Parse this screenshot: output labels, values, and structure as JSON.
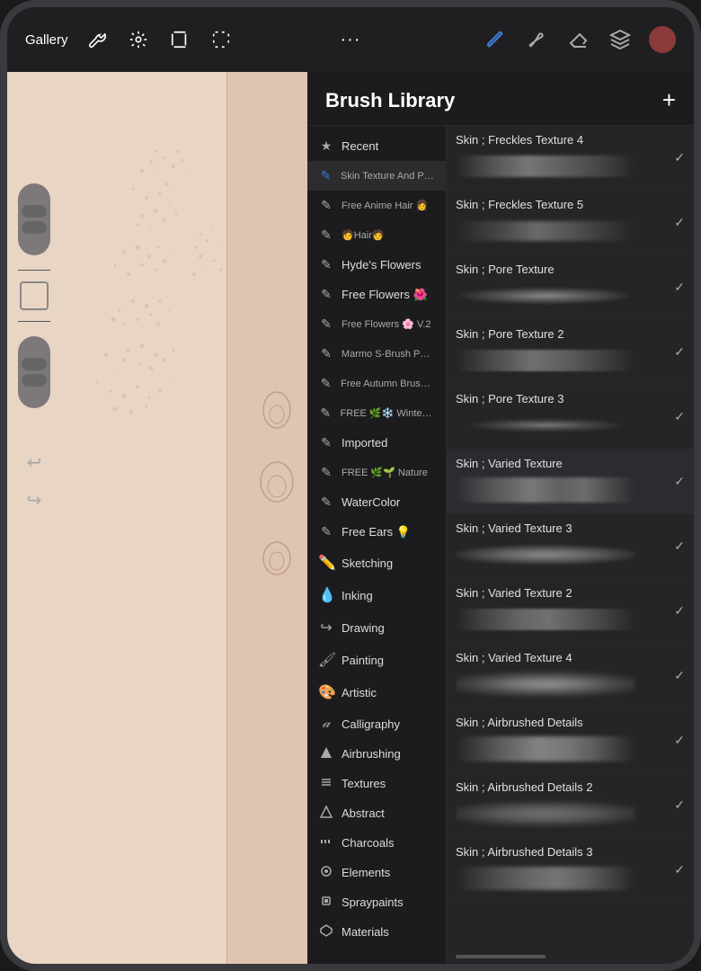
{
  "app": {
    "title": "Brush Library",
    "gallery_label": "Gallery"
  },
  "toolbar": {
    "add_label": "+",
    "three_dots": "···"
  },
  "categories": [
    {
      "id": "recent",
      "icon": "★",
      "label": "Recent",
      "active": false,
      "small": false
    },
    {
      "id": "skin-texture",
      "icon": "✎",
      "label": "Skin Texture And Por...",
      "active": true,
      "small": true
    },
    {
      "id": "free-anime",
      "icon": "✎",
      "label": "Free Anime Hair 👩",
      "active": false,
      "small": true
    },
    {
      "id": "hair",
      "icon": "✎",
      "label": "🧑Hair🧑",
      "active": false,
      "small": true
    },
    {
      "id": "hydes-flowers",
      "icon": "✎",
      "label": "Hyde's Flowers",
      "active": false,
      "small": false
    },
    {
      "id": "free-flowers",
      "icon": "✎",
      "label": "Free Flowers 🌺",
      "active": false,
      "small": false
    },
    {
      "id": "free-flowers2",
      "icon": "✎",
      "label": "Free Flowers 🌸 V.2",
      "active": false,
      "small": true
    },
    {
      "id": "marmo",
      "icon": "✎",
      "label": "Marmo S-Brush Pack",
      "active": false,
      "small": true
    },
    {
      "id": "free-autumn",
      "icon": "✎",
      "label": "Free Autumn Brushe...",
      "active": false,
      "small": true
    },
    {
      "id": "free-winter",
      "icon": "✎",
      "label": "FREE 🌿❄️ Winter N...",
      "active": false,
      "small": true
    },
    {
      "id": "imported",
      "icon": "✎",
      "label": "Imported",
      "active": false,
      "small": false
    },
    {
      "id": "free-nature",
      "icon": "✎",
      "label": "FREE 🌿🌱 Nature",
      "active": false,
      "small": true
    },
    {
      "id": "watercolor",
      "icon": "✎",
      "label": "WaterColor",
      "active": false,
      "small": false
    },
    {
      "id": "free-ears",
      "icon": "✎",
      "label": "Free Ears 💡",
      "active": false,
      "small": false
    },
    {
      "id": "sketching",
      "icon": "✏",
      "label": "Sketching",
      "active": false,
      "small": false
    },
    {
      "id": "inking",
      "icon": "💧",
      "label": "Inking",
      "active": false,
      "small": false
    },
    {
      "id": "drawing",
      "icon": "↩",
      "label": "Drawing",
      "active": false,
      "small": false
    },
    {
      "id": "painting",
      "icon": "🖌",
      "label": "Painting",
      "active": false,
      "small": false
    },
    {
      "id": "artistic",
      "icon": "🎨",
      "label": "Artistic",
      "active": false,
      "small": false
    },
    {
      "id": "calligraphy",
      "icon": "𝒶",
      "label": "Calligraphy",
      "active": false,
      "small": false
    },
    {
      "id": "airbrushing",
      "icon": "🔺",
      "label": "Airbrushing",
      "active": false,
      "small": false
    },
    {
      "id": "textures",
      "icon": "▦",
      "label": "Textures",
      "active": false,
      "small": false
    },
    {
      "id": "abstract",
      "icon": "△",
      "label": "Abstract",
      "active": false,
      "small": false
    },
    {
      "id": "charcoals",
      "icon": "▐▐▐",
      "label": "Charcoals",
      "active": false,
      "small": false
    },
    {
      "id": "elements",
      "icon": "◎",
      "label": "Elements",
      "active": false,
      "small": false
    },
    {
      "id": "spraypaints",
      "icon": "▣",
      "label": "Spraypaints",
      "active": false,
      "small": false
    },
    {
      "id": "materials",
      "icon": "⬡",
      "label": "Materials",
      "active": false,
      "small": false
    }
  ],
  "brushes": [
    {
      "id": "freckles4",
      "name": "Skin ; Freckles Texture 4",
      "stroke": "stroke-freckles4",
      "selected": false
    },
    {
      "id": "freckles5",
      "name": "Skin ; Freckles Texture 5",
      "stroke": "stroke-freckles5",
      "selected": false
    },
    {
      "id": "pore",
      "name": "Skin ; Pore Texture",
      "stroke": "stroke-pore",
      "selected": false
    },
    {
      "id": "pore2",
      "name": "Skin ; Pore Texture 2",
      "stroke": "stroke-pore2",
      "selected": false
    },
    {
      "id": "pore3",
      "name": "Skin ; Pore Texture 3",
      "stroke": "stroke-pore3",
      "selected": false
    },
    {
      "id": "varied",
      "name": "Skin ; Varied Texture",
      "stroke": "stroke-varied",
      "selected": true
    },
    {
      "id": "varied3",
      "name": "Skin ; Varied Texture 3",
      "stroke": "stroke-varied3",
      "selected": false
    },
    {
      "id": "varied2",
      "name": "Skin ; Varied Texture 2",
      "stroke": "stroke-varied2",
      "selected": false
    },
    {
      "id": "varied4",
      "name": "Skin ; Varied Texture 4",
      "stroke": "stroke-varied4",
      "selected": false
    },
    {
      "id": "airbrush",
      "name": "Skin ; Airbrushed Details",
      "stroke": "stroke-airbrush",
      "selected": false
    },
    {
      "id": "airbrush2",
      "name": "Skin ; Airbrushed Details 2",
      "stroke": "stroke-airbrush2",
      "selected": false
    },
    {
      "id": "airbrush3",
      "name": "Skin ; Airbrushed Details 3",
      "stroke": "stroke-airbrush3",
      "selected": false
    }
  ],
  "colors": {
    "accent_blue": "#3a7bd5",
    "header_bg": "rgba(30,30,34,0.92)",
    "panel_bg": "#1c1c1e",
    "brush_list_bg": "#252527",
    "active_cat_bg": "#2c2c2e",
    "canvas_bg": "#e8d5c4"
  }
}
